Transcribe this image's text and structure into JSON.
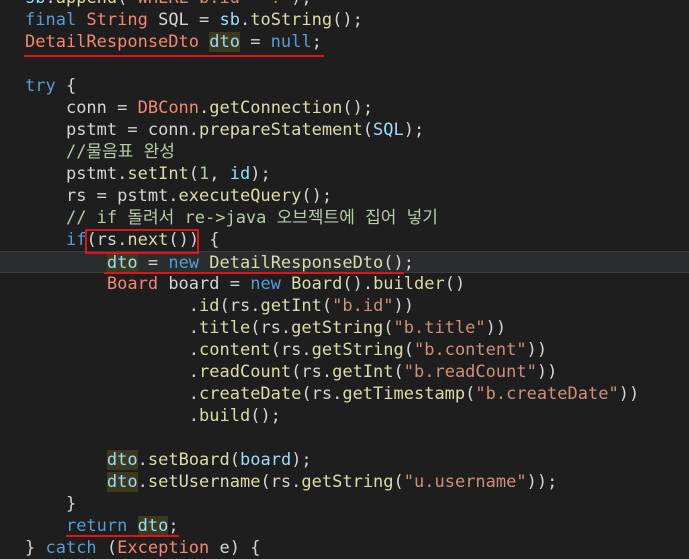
{
  "lines": [
    {
      "tokens": [
        [
          "var",
          "sb"
        ],
        [
          "id",
          "."
        ],
        [
          "fn",
          "append"
        ],
        [
          "id",
          "("
        ],
        [
          "str",
          "\"WHERE b.id = ?\""
        ],
        [
          "id",
          ");"
        ]
      ]
    },
    {
      "tokens": [
        [
          "kw",
          "final "
        ],
        [
          "cls",
          "String "
        ],
        [
          "id",
          "SQL = "
        ],
        [
          "var",
          "sb"
        ],
        [
          "id",
          "."
        ],
        [
          "fn",
          "toString"
        ],
        [
          "id",
          "();"
        ]
      ]
    },
    {
      "tokens": [
        [
          "cls",
          "DetailResponseDto "
        ],
        [
          "hl",
          "dto"
        ],
        [
          "id",
          " = "
        ],
        [
          "kw",
          "null"
        ],
        [
          "id",
          ";"
        ]
      ]
    },
    {
      "tokens": []
    },
    {
      "tokens": [
        [
          "kw",
          "try "
        ],
        [
          "id",
          "{"
        ]
      ]
    },
    {
      "tokens": [
        [
          "id",
          "    "
        ],
        [
          "id",
          "conn = "
        ],
        [
          "cls",
          "DBConn"
        ],
        [
          "id",
          "."
        ],
        [
          "fn",
          "getConnection"
        ],
        [
          "id",
          "();"
        ]
      ]
    },
    {
      "tokens": [
        [
          "id",
          "    "
        ],
        [
          "id",
          "pstmt = conn."
        ],
        [
          "fn",
          "prepareStatement"
        ],
        [
          "id",
          "("
        ],
        [
          "var",
          "SQL"
        ],
        [
          "id",
          ");"
        ]
      ]
    },
    {
      "tokens": [
        [
          "id",
          "    "
        ],
        [
          "cmt",
          "//물음표 완성"
        ]
      ]
    },
    {
      "tokens": [
        [
          "id",
          "    "
        ],
        [
          "id",
          "pstmt."
        ],
        [
          "fn",
          "setInt"
        ],
        [
          "id",
          "("
        ],
        [
          "num",
          "1"
        ],
        [
          "id",
          ", "
        ],
        [
          "var",
          "id"
        ],
        [
          "id",
          ");"
        ]
      ]
    },
    {
      "tokens": [
        [
          "id",
          "    "
        ],
        [
          "id",
          "rs = pstmt."
        ],
        [
          "fn",
          "executeQuery"
        ],
        [
          "id",
          "();"
        ]
      ]
    },
    {
      "tokens": [
        [
          "id",
          "    "
        ],
        [
          "cmt",
          "// if 돌려서 re->java 오브젝트에 집어 넣기"
        ]
      ]
    },
    {
      "tokens": [
        [
          "id",
          "    "
        ],
        [
          "kw",
          "if"
        ],
        [
          "id",
          "(rs."
        ],
        [
          "fn",
          "next"
        ],
        [
          "id",
          "()) {"
        ]
      ]
    },
    {
      "tokens": [
        [
          "id",
          "        "
        ],
        [
          "hl",
          "dto"
        ],
        [
          "id",
          " = "
        ],
        [
          "kw",
          "new "
        ],
        [
          "fn",
          "DetailResponseDto"
        ],
        [
          "id",
          "();"
        ]
      ]
    },
    {
      "tokens": [
        [
          "id",
          "        "
        ],
        [
          "cls",
          "Board "
        ],
        [
          "id",
          "board = "
        ],
        [
          "kw",
          "new "
        ],
        [
          "fn",
          "Board"
        ],
        [
          "id",
          "()."
        ],
        [
          "fn",
          "builder"
        ],
        [
          "id",
          "()"
        ]
      ]
    },
    {
      "tokens": [
        [
          "id",
          "                "
        ],
        [
          "id",
          "."
        ],
        [
          "fn",
          "id"
        ],
        [
          "id",
          "(rs."
        ],
        [
          "fn",
          "getInt"
        ],
        [
          "id",
          "("
        ],
        [
          "str",
          "\"b.id\""
        ],
        [
          "id",
          "))"
        ]
      ]
    },
    {
      "tokens": [
        [
          "id",
          "                "
        ],
        [
          "id",
          "."
        ],
        [
          "fn",
          "title"
        ],
        [
          "id",
          "(rs."
        ],
        [
          "fn",
          "getString"
        ],
        [
          "id",
          "("
        ],
        [
          "str",
          "\"b.title\""
        ],
        [
          "id",
          "))"
        ]
      ]
    },
    {
      "tokens": [
        [
          "id",
          "                "
        ],
        [
          "id",
          "."
        ],
        [
          "fn",
          "content"
        ],
        [
          "id",
          "(rs."
        ],
        [
          "fn",
          "getString"
        ],
        [
          "id",
          "("
        ],
        [
          "str",
          "\"b.content\""
        ],
        [
          "id",
          "))"
        ]
      ]
    },
    {
      "tokens": [
        [
          "id",
          "                "
        ],
        [
          "id",
          "."
        ],
        [
          "fn",
          "readCount"
        ],
        [
          "id",
          "(rs."
        ],
        [
          "fn",
          "getInt"
        ],
        [
          "id",
          "("
        ],
        [
          "str",
          "\"b.readCount\""
        ],
        [
          "id",
          "))"
        ]
      ]
    },
    {
      "tokens": [
        [
          "id",
          "                "
        ],
        [
          "id",
          "."
        ],
        [
          "fn",
          "createDate"
        ],
        [
          "id",
          "(rs."
        ],
        [
          "fn",
          "getTimestamp"
        ],
        [
          "id",
          "("
        ],
        [
          "str",
          "\"b.createDate\""
        ],
        [
          "id",
          "))"
        ]
      ]
    },
    {
      "tokens": [
        [
          "id",
          "                "
        ],
        [
          "id",
          "."
        ],
        [
          "fn",
          "build"
        ],
        [
          "id",
          "();"
        ]
      ]
    },
    {
      "tokens": []
    },
    {
      "tokens": [
        [
          "id",
          "        "
        ],
        [
          "hl",
          "dto"
        ],
        [
          "id",
          "."
        ],
        [
          "fn",
          "setBoard"
        ],
        [
          "id",
          "("
        ],
        [
          "var",
          "board"
        ],
        [
          "id",
          ");"
        ]
      ]
    },
    {
      "tokens": [
        [
          "id",
          "        "
        ],
        [
          "hl",
          "dto"
        ],
        [
          "id",
          "."
        ],
        [
          "fn",
          "setUsername"
        ],
        [
          "id",
          "(rs."
        ],
        [
          "fn",
          "getString"
        ],
        [
          "id",
          "("
        ],
        [
          "str",
          "\"u.username\""
        ],
        [
          "id",
          "));"
        ]
      ]
    },
    {
      "tokens": [
        [
          "id",
          "    "
        ],
        [
          "id",
          "}"
        ]
      ]
    },
    {
      "tokens": [
        [
          "id",
          "    "
        ],
        [
          "kw",
          "return "
        ],
        [
          "hl",
          "dto"
        ],
        [
          "id",
          ";"
        ]
      ]
    },
    {
      "tokens": [
        [
          "id",
          "} "
        ],
        [
          "kw",
          "catch "
        ],
        [
          "id",
          "("
        ],
        [
          "cls",
          "Exception "
        ],
        [
          "id",
          "e) {"
        ]
      ]
    }
  ],
  "current_line": 12
}
